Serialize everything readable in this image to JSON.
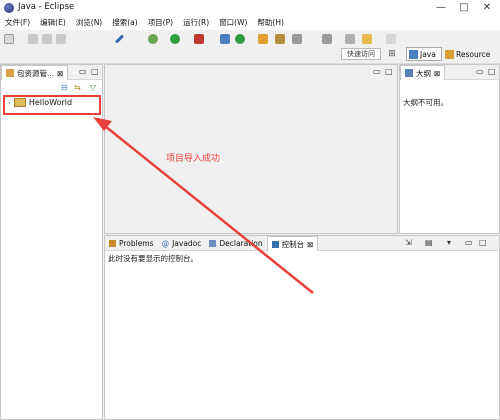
{
  "window": {
    "title": "Java - Eclipse",
    "controls": {
      "minimize": "—",
      "maximize": "□",
      "close": "✕"
    }
  },
  "menu": [
    "文件(F)",
    "编辑(E)",
    "浏览(N)",
    "搜索(a)",
    "项目(P)",
    "运行(R)",
    "窗口(W)",
    "帮助(H)"
  ],
  "toolbar": {
    "quick_access": "快速访问"
  },
  "perspectives": {
    "java": "Java",
    "resource": "Resource"
  },
  "package_explorer": {
    "tab_label": "包资源管...",
    "tab_close": "⊠",
    "project": "HelloWorld"
  },
  "outline": {
    "tab_label": "大纲",
    "tab_close": "⊠",
    "message": "大纲不可用。"
  },
  "bottom_panel": {
    "tabs": [
      "Problems",
      "Javadoc",
      "Declaration",
      "控制台"
    ],
    "active_tab_close": "⊠",
    "console_message": "此时没有要显示的控制台。"
  },
  "annotation": {
    "text": "项目导入成功",
    "color": "#e8403a"
  }
}
